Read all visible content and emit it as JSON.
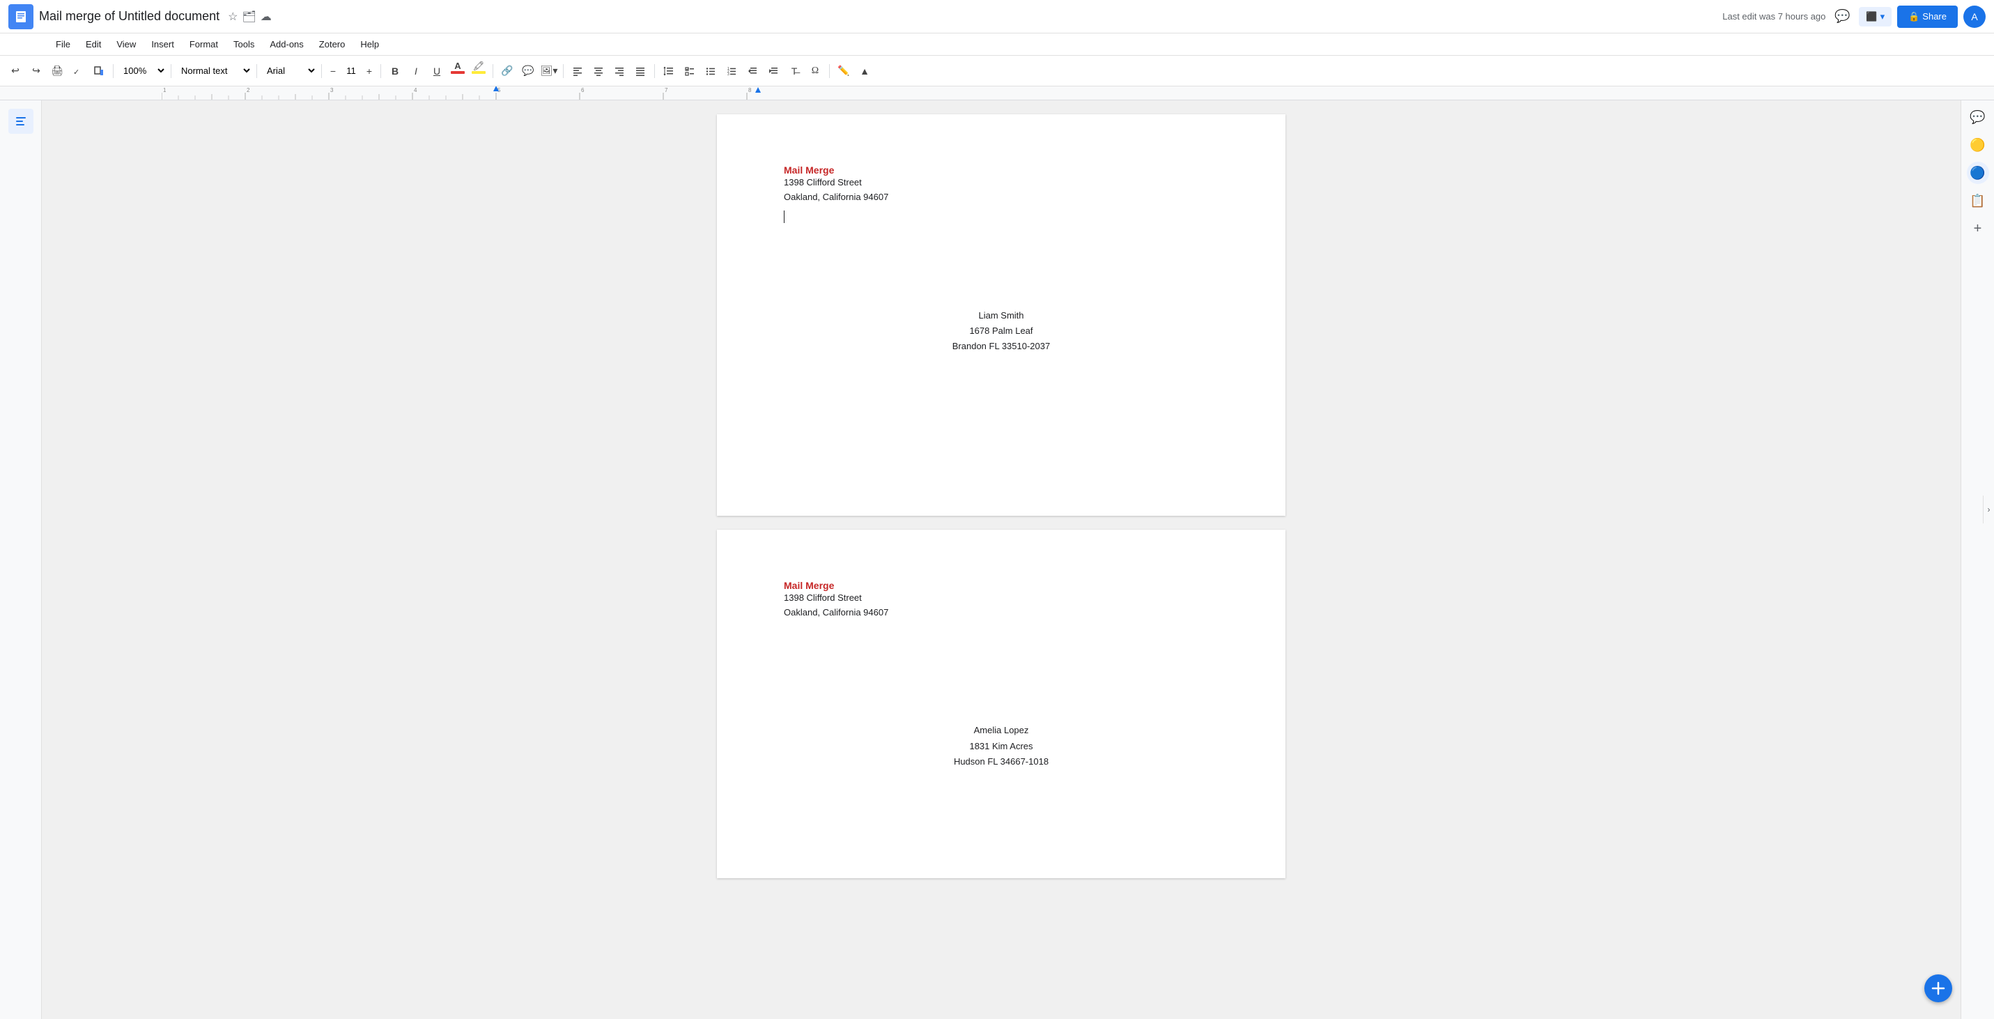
{
  "app": {
    "icon": "📄",
    "title": "Mail merge of Untitled document",
    "title_icons": [
      "☆",
      "🗂",
      "☁"
    ],
    "last_edit": "Last edit was 7 hours ago"
  },
  "menu": {
    "items": [
      "File",
      "Edit",
      "View",
      "Insert",
      "Format",
      "Tools",
      "Add-ons",
      "Zotero",
      "Help"
    ]
  },
  "toolbar": {
    "undo_label": "↩",
    "redo_label": "↪",
    "print_label": "🖨",
    "spellcheck_label": "✓",
    "paint_label": "🎨",
    "zoom_value": "100%",
    "style_value": "Normal text",
    "font_value": "Arial",
    "font_size": "11",
    "bold_label": "B",
    "italic_label": "I",
    "underline_label": "U",
    "link_label": "🔗",
    "comment_label": "💬",
    "image_label": "🖼",
    "align_left": "≡",
    "align_center": "≡",
    "align_right": "≡",
    "align_justify": "≡",
    "pen_label": "✏"
  },
  "pages": [
    {
      "sender_name": "Mail Merge",
      "sender_street": "1398 Clifford Street",
      "sender_city": "Oakland, California 94607",
      "recipient_name": "Liam Smith",
      "recipient_street": "1678 Palm Leaf",
      "recipient_city": "Brandon FL 33510-2037",
      "has_cursor": true
    },
    {
      "sender_name": "Mail Merge",
      "sender_street": "1398 Clifford Street",
      "sender_city": "Oakland, California 94607",
      "recipient_name": "Amelia Lopez",
      "recipient_street": "1831 Kim Acres",
      "recipient_city": "Hudson FL 34667-1018",
      "has_cursor": false
    }
  ],
  "right_panel": {
    "icons": [
      "💬",
      "⬜",
      "🔵",
      "📋",
      "➕"
    ]
  },
  "colors": {
    "sender_name": "#c62828",
    "accent": "#1a73e8"
  }
}
